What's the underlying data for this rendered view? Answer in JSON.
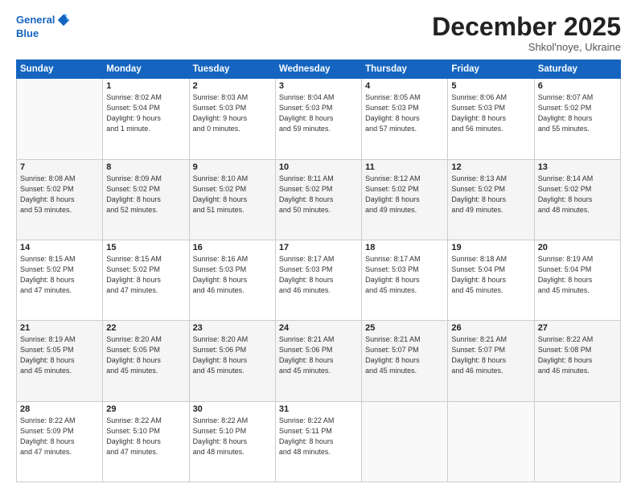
{
  "logo": {
    "line1": "General",
    "line2": "Blue"
  },
  "header": {
    "month": "December 2025",
    "location": "Shkol'noye, Ukraine"
  },
  "weekdays": [
    "Sunday",
    "Monday",
    "Tuesday",
    "Wednesday",
    "Thursday",
    "Friday",
    "Saturday"
  ],
  "weeks": [
    [
      {
        "day": "",
        "info": ""
      },
      {
        "day": "1",
        "info": "Sunrise: 8:02 AM\nSunset: 5:04 PM\nDaylight: 9 hours\nand 1 minute."
      },
      {
        "day": "2",
        "info": "Sunrise: 8:03 AM\nSunset: 5:03 PM\nDaylight: 9 hours\nand 0 minutes."
      },
      {
        "day": "3",
        "info": "Sunrise: 8:04 AM\nSunset: 5:03 PM\nDaylight: 8 hours\nand 59 minutes."
      },
      {
        "day": "4",
        "info": "Sunrise: 8:05 AM\nSunset: 5:03 PM\nDaylight: 8 hours\nand 57 minutes."
      },
      {
        "day": "5",
        "info": "Sunrise: 8:06 AM\nSunset: 5:03 PM\nDaylight: 8 hours\nand 56 minutes."
      },
      {
        "day": "6",
        "info": "Sunrise: 8:07 AM\nSunset: 5:02 PM\nDaylight: 8 hours\nand 55 minutes."
      }
    ],
    [
      {
        "day": "7",
        "info": "Sunrise: 8:08 AM\nSunset: 5:02 PM\nDaylight: 8 hours\nand 53 minutes."
      },
      {
        "day": "8",
        "info": "Sunrise: 8:09 AM\nSunset: 5:02 PM\nDaylight: 8 hours\nand 52 minutes."
      },
      {
        "day": "9",
        "info": "Sunrise: 8:10 AM\nSunset: 5:02 PM\nDaylight: 8 hours\nand 51 minutes."
      },
      {
        "day": "10",
        "info": "Sunrise: 8:11 AM\nSunset: 5:02 PM\nDaylight: 8 hours\nand 50 minutes."
      },
      {
        "day": "11",
        "info": "Sunrise: 8:12 AM\nSunset: 5:02 PM\nDaylight: 8 hours\nand 49 minutes."
      },
      {
        "day": "12",
        "info": "Sunrise: 8:13 AM\nSunset: 5:02 PM\nDaylight: 8 hours\nand 49 minutes."
      },
      {
        "day": "13",
        "info": "Sunrise: 8:14 AM\nSunset: 5:02 PM\nDaylight: 8 hours\nand 48 minutes."
      }
    ],
    [
      {
        "day": "14",
        "info": "Sunrise: 8:15 AM\nSunset: 5:02 PM\nDaylight: 8 hours\nand 47 minutes."
      },
      {
        "day": "15",
        "info": "Sunrise: 8:15 AM\nSunset: 5:02 PM\nDaylight: 8 hours\nand 47 minutes."
      },
      {
        "day": "16",
        "info": "Sunrise: 8:16 AM\nSunset: 5:03 PM\nDaylight: 8 hours\nand 46 minutes."
      },
      {
        "day": "17",
        "info": "Sunrise: 8:17 AM\nSunset: 5:03 PM\nDaylight: 8 hours\nand 46 minutes."
      },
      {
        "day": "18",
        "info": "Sunrise: 8:17 AM\nSunset: 5:03 PM\nDaylight: 8 hours\nand 45 minutes."
      },
      {
        "day": "19",
        "info": "Sunrise: 8:18 AM\nSunset: 5:04 PM\nDaylight: 8 hours\nand 45 minutes."
      },
      {
        "day": "20",
        "info": "Sunrise: 8:19 AM\nSunset: 5:04 PM\nDaylight: 8 hours\nand 45 minutes."
      }
    ],
    [
      {
        "day": "21",
        "info": "Sunrise: 8:19 AM\nSunset: 5:05 PM\nDaylight: 8 hours\nand 45 minutes."
      },
      {
        "day": "22",
        "info": "Sunrise: 8:20 AM\nSunset: 5:05 PM\nDaylight: 8 hours\nand 45 minutes."
      },
      {
        "day": "23",
        "info": "Sunrise: 8:20 AM\nSunset: 5:06 PM\nDaylight: 8 hours\nand 45 minutes."
      },
      {
        "day": "24",
        "info": "Sunrise: 8:21 AM\nSunset: 5:06 PM\nDaylight: 8 hours\nand 45 minutes."
      },
      {
        "day": "25",
        "info": "Sunrise: 8:21 AM\nSunset: 5:07 PM\nDaylight: 8 hours\nand 45 minutes."
      },
      {
        "day": "26",
        "info": "Sunrise: 8:21 AM\nSunset: 5:07 PM\nDaylight: 8 hours\nand 46 minutes."
      },
      {
        "day": "27",
        "info": "Sunrise: 8:22 AM\nSunset: 5:08 PM\nDaylight: 8 hours\nand 46 minutes."
      }
    ],
    [
      {
        "day": "28",
        "info": "Sunrise: 8:22 AM\nSunset: 5:09 PM\nDaylight: 8 hours\nand 47 minutes."
      },
      {
        "day": "29",
        "info": "Sunrise: 8:22 AM\nSunset: 5:10 PM\nDaylight: 8 hours\nand 47 minutes."
      },
      {
        "day": "30",
        "info": "Sunrise: 8:22 AM\nSunset: 5:10 PM\nDaylight: 8 hours\nand 48 minutes."
      },
      {
        "day": "31",
        "info": "Sunrise: 8:22 AM\nSunset: 5:11 PM\nDaylight: 8 hours\nand 48 minutes."
      },
      {
        "day": "",
        "info": ""
      },
      {
        "day": "",
        "info": ""
      },
      {
        "day": "",
        "info": ""
      }
    ]
  ]
}
